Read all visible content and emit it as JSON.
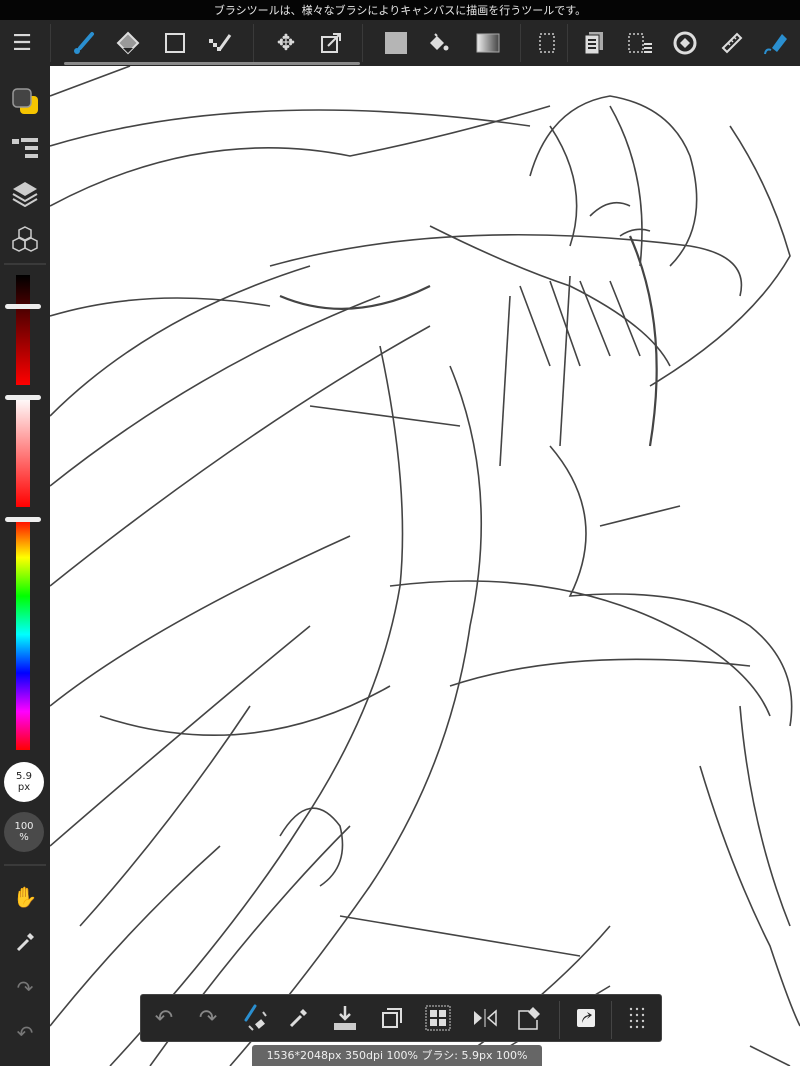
{
  "status_message": "ブラシツールは、様々なブラシによりキャンバスに描画を行うツールです。",
  "colors": {
    "accent": "#2a8fd0",
    "toolbar_bg": "#262626",
    "primary_color": "#444444",
    "secondary_color": "#f5c400"
  },
  "toolbar": {
    "items": [
      {
        "name": "menu",
        "icon": "hamburger-icon"
      },
      {
        "name": "brush",
        "icon": "brush-icon",
        "active": true
      },
      {
        "name": "eraser",
        "icon": "eraser-icon"
      },
      {
        "name": "shape",
        "icon": "rectangle-icon"
      },
      {
        "name": "dot",
        "icon": "dot-pen-icon"
      },
      {
        "name": "move",
        "icon": "move-icon"
      },
      {
        "name": "transform",
        "icon": "transform-icon"
      },
      {
        "name": "fill",
        "icon": "fill-rect-icon"
      },
      {
        "name": "bucket",
        "icon": "bucket-icon"
      },
      {
        "name": "gradient",
        "icon": "gradient-icon"
      },
      {
        "name": "select",
        "icon": "selection-icon"
      },
      {
        "name": "copy",
        "icon": "copy-icon"
      },
      {
        "name": "select-menu",
        "icon": "selection-menu-icon"
      },
      {
        "name": "rotate",
        "icon": "rotate-icon"
      },
      {
        "name": "ruler",
        "icon": "ruler-icon"
      },
      {
        "name": "pen",
        "icon": "pen-icon"
      }
    ]
  },
  "sidebar": {
    "brush_size": {
      "value": "5.9",
      "unit": "px"
    },
    "opacity": {
      "value": "100",
      "unit": "%"
    },
    "sliders": {
      "brightness": 0.3,
      "saturation": 0.0,
      "hue": 0.0
    }
  },
  "bottom_toolbar": {
    "items": [
      "undo-icon",
      "redo-icon",
      "brush-eraser-toggle-icon",
      "eyedropper-icon",
      "import-icon",
      "copy-layer-icon",
      "grid-icon",
      "flip-icon",
      "clear-icon",
      "share-icon",
      "more-icon"
    ]
  },
  "info_bar": "1536*2048px 350dpi 100% ブラシ: 5.9px 100%"
}
